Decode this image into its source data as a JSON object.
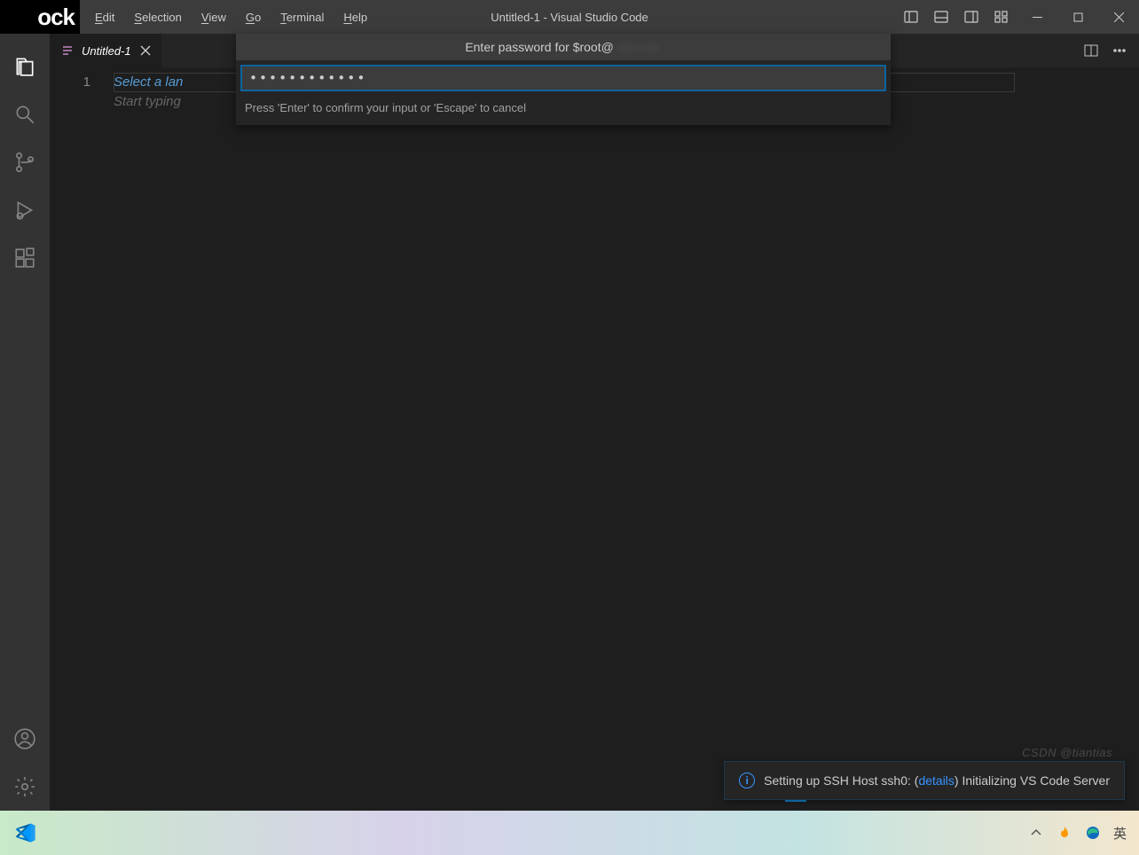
{
  "titlebar": {
    "logo_fragment": "ock",
    "menu": {
      "edit": "Edit",
      "selection": "Selection",
      "view": "View",
      "go": "Go",
      "terminal": "Terminal",
      "help": "Help"
    },
    "title": "Untitled-1 - Visual Studio Code"
  },
  "activity": {
    "explorer": "explorer-icon",
    "search": "search-icon",
    "scm": "source-control-icon",
    "debug": "debug-icon",
    "extensions": "extensions-icon",
    "account": "account-icon",
    "settings": "gear-icon"
  },
  "tabs": {
    "items": [
      {
        "label": "Untitled-1"
      }
    ]
  },
  "editor": {
    "line_number": "1",
    "placeholder_line1": "Select a lan",
    "placeholder_line2": "Start typing"
  },
  "palette": {
    "title_prefix": "Enter password for $root@",
    "title_blurred": "····· ····",
    "value": "••••••••••••",
    "hint": "Press 'Enter' to confirm your input or 'Escape' to cancel"
  },
  "toast": {
    "prefix": "Setting up SSH Host ssh0: (",
    "link": "details",
    "suffix": ") Initializing VS Code Server"
  },
  "taskbar": {
    "ime": "英",
    "watermark": "CSDN @tiantias"
  }
}
